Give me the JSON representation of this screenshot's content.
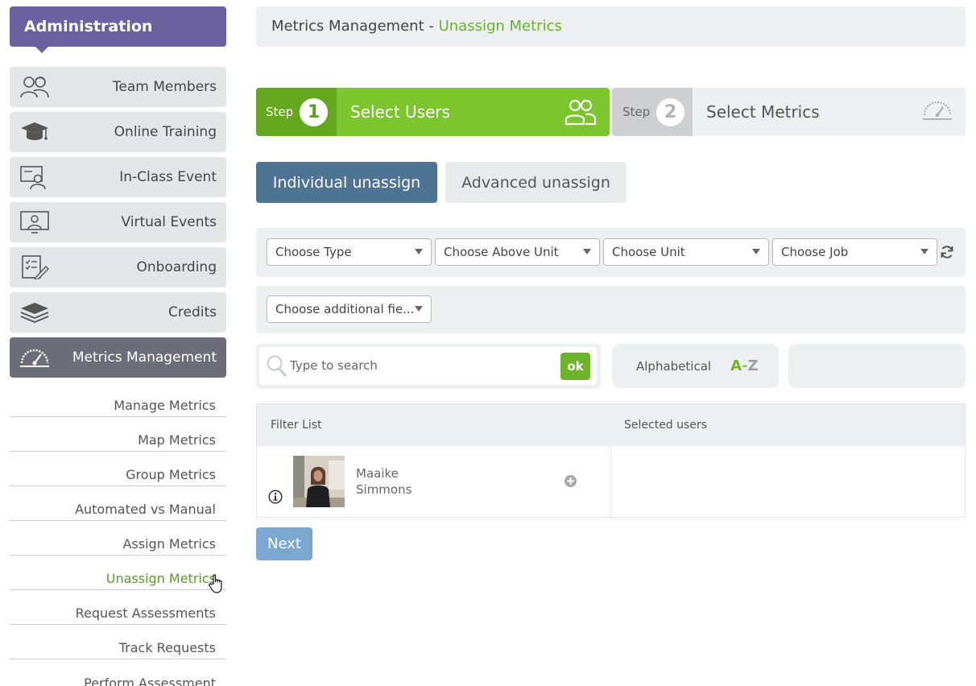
{
  "sidebar": {
    "header": "Administration",
    "items": [
      {
        "label": "Team Members",
        "icon": "team-members-icon"
      },
      {
        "label": "Online Training",
        "icon": "graduation-cap-icon"
      },
      {
        "label": "In-Class Event",
        "icon": "presenter-board-icon"
      },
      {
        "label": "Virtual Events",
        "icon": "virtual-screen-icon"
      },
      {
        "label": "Onboarding",
        "icon": "checklist-icon"
      },
      {
        "label": "Credits",
        "icon": "stack-layers-icon"
      },
      {
        "label": "Metrics Management",
        "icon": "speedometer-icon"
      }
    ],
    "sub_items": [
      "Manage Metrics",
      "Map Metrics",
      "Group Metrics",
      "Automated vs Manual",
      "Assign Metrics",
      "Unassign Metrics",
      "Request Assessments",
      "Track Requests",
      "Perform Assessment"
    ]
  },
  "breadcrumb": {
    "section": "Metrics Management",
    "separator": " - ",
    "current": "Unassign Metrics"
  },
  "steps": [
    {
      "word": "Step",
      "number": "1",
      "title": "Select Users",
      "icon": "users-icon"
    },
    {
      "word": "Step",
      "number": "2",
      "title": "Select Metrics",
      "icon": "speedometer-icon"
    }
  ],
  "tabs": {
    "individual": "Individual unassign",
    "advanced": "Advanced unassign"
  },
  "filters": {
    "type": "Choose Type",
    "above_unit": "Choose Above Unit",
    "unit": "Choose Unit",
    "job": "Choose Job",
    "additional": "Choose additional fie..."
  },
  "search": {
    "placeholder": "Type to search",
    "ok": "ok"
  },
  "sort": {
    "label": "Alphabetical",
    "a": "A",
    "dash": "-",
    "z": "Z"
  },
  "lists": {
    "filter_header": "Filter List",
    "selected_header": "Selected users"
  },
  "users": [
    {
      "first": "Maaike",
      "last": "Simmons"
    }
  ],
  "next_label": "Next",
  "colors": {
    "brand_purple": "#6a619e",
    "accent_green": "#7cc52f",
    "tab_blue": "#4e7393",
    "next_blue": "#7ba7d1"
  }
}
